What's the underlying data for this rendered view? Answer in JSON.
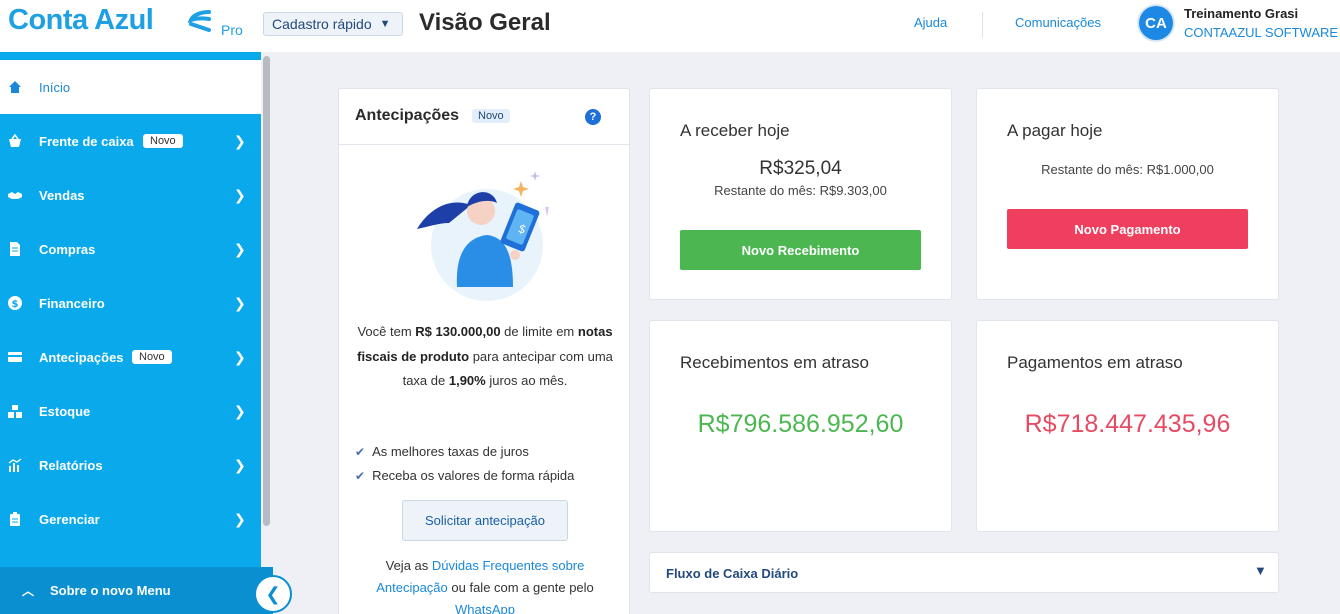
{
  "brand": {
    "name": "Conta Azul",
    "tier": "Pro",
    "color": "#1ea0e3"
  },
  "header": {
    "quick_button": "Cadastro rápido",
    "page_title": "Visão Geral",
    "links": {
      "help": "Ajuda",
      "communications": "Comunicações"
    },
    "user": {
      "initials": "CA",
      "name": "Treinamento Grasi",
      "company": "CONTAAZUL SOFTWARE"
    }
  },
  "sidebar": {
    "items": [
      {
        "label": "Início",
        "icon": "home-icon"
      },
      {
        "label": "Frente de caixa",
        "badge": "Novo",
        "icon": "basket-icon"
      },
      {
        "label": "Vendas",
        "icon": "handshake-icon"
      },
      {
        "label": "Compras",
        "icon": "document-icon"
      },
      {
        "label": "Financeiro",
        "icon": "dollar-icon"
      },
      {
        "label": "Antecipações",
        "badge": "Novo",
        "icon": "card-icon"
      },
      {
        "label": "Estoque",
        "icon": "boxes-icon"
      },
      {
        "label": "Relatórios",
        "icon": "chart-icon"
      },
      {
        "label": "Gerenciar",
        "icon": "clipboard-icon"
      }
    ],
    "footer": "Sobre o novo Menu"
  },
  "anticipation": {
    "title": "Antecipações",
    "badge": "Novo",
    "text_1": "Você tem ",
    "limit": "R$ 130.000,00",
    "text_2": " de limite em ",
    "products": "notas fiscais de produto",
    "text_3": " para antecipar com uma taxa de ",
    "rate": "1,90%",
    "text_4": " juros ao mês.",
    "benefits": [
      "As melhores taxas de juros",
      "Receba os valores de forma rápida"
    ],
    "button": "Solicitar antecipação",
    "footer_1": "Veja as ",
    "footer_link_1": "Dúvidas Frequentes sobre Antecipação",
    "footer_2": " ou fale com a gente pelo ",
    "footer_link_2": "WhatsApp"
  },
  "receivables_today": {
    "title": "A receber hoje",
    "value": "R$325,04",
    "month_remaining": "Restante do mês: R$9.303,00",
    "button": "Novo Recebimento",
    "button_color": "#4cb751"
  },
  "payables_today": {
    "title": "A pagar hoje",
    "month_remaining": "Restante do mês: R$1.000,00",
    "button": "Novo Pagamento",
    "button_color": "#ee3f5e"
  },
  "late_receipts": {
    "title": "Recebimentos em atraso",
    "value": "R$796.586.952,60",
    "color": "#4cb751"
  },
  "late_payments": {
    "title": "Pagamentos em atraso",
    "value": "R$718.447.435,96",
    "color": "#e54b63"
  },
  "cash_flow": {
    "label": "Fluxo de Caixa Diário"
  }
}
